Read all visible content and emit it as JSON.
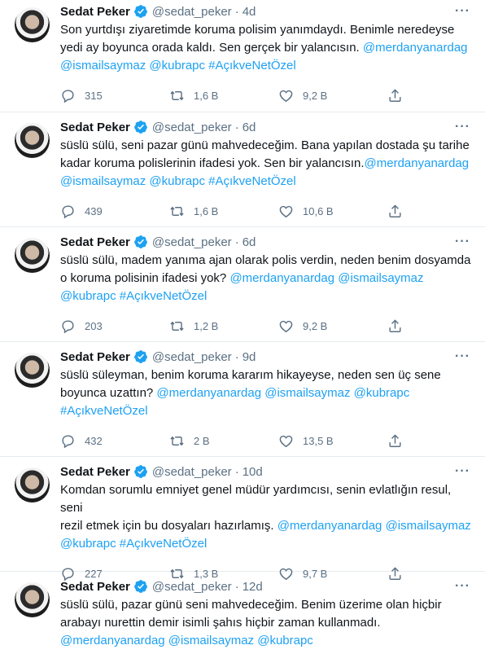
{
  "tweets": [
    {
      "name": "Sedat Peker",
      "handle": "@sedat_peker",
      "time": "4d",
      "text": "Son yurtdışı ziyaretimde koruma polisim yanımdaydı. Benimle neredeyse\nyedi ay boyunca orada kaldı. Sen gerçek bir yalancısın. ",
      "links": "@merdanyanardag\n@ismailsaymaz @kubrapc #AçıkveNetÖzel",
      "replies": "315",
      "retweets": "1,6 B",
      "likes": "9,2 B"
    },
    {
      "name": "Sedat Peker",
      "handle": "@sedat_peker",
      "time": "6d",
      "text": "süslü sülü, seni pazar günü mahvedeceğim. Bana yapılan dostada şu tarihe\nkadar koruma polislerinin ifadesi yok. Sen bir yalancısın.",
      "links": "@merdanyanardag\n@ismailsaymaz @kubrapc #AçıkveNetÖzel",
      "replies": "439",
      "retweets": "1,6 B",
      "likes": "10,6 B"
    },
    {
      "name": "Sedat Peker",
      "handle": "@sedat_peker",
      "time": "6d",
      "text": "süslü sülü, madem yanıma ajan olarak polis verdin, neden benim dosyamda\no koruma polisinin ifadesi yok? ",
      "links": "@merdanyanardag @ismailsaymaz\n@kubrapc #AçıkveNetÖzel",
      "replies": "203",
      "retweets": "1,2 B",
      "likes": "9,2 B"
    },
    {
      "name": "Sedat Peker",
      "handle": "@sedat_peker",
      "time": "9d",
      "text": "süslü süleyman, benim koruma kararım hikayeyse, neden sen üç sene\nboyunca uzattın? ",
      "links": "@merdanyanardag @ismailsaymaz @kubrapc\n#AçıkveNetÖzel",
      "replies": "432",
      "retweets": "2 B",
      "likes": "13,5 B"
    },
    {
      "name": "Sedat Peker",
      "handle": "@sedat_peker",
      "time": "10d",
      "text": "Komdan sorumlu emniyet genel müdür yardımcısı, senin evlatlığın resul, seni\nrezil etmek için bu dosyaları hazırlamış. ",
      "links": "@merdanyanardag @ismailsaymaz\n@kubrapc #AçıkveNetÖzel",
      "replies": "227",
      "retweets": "1,3 B",
      "likes": "9,7 B"
    },
    {
      "name": "Sedat Peker",
      "handle": "@sedat_peker",
      "time": "12d",
      "text": "süslü sülü, pazar günü seni mahvedeceğim. Benim üzerime olan hiçbir\narabayı nurettin demir isimli şahıs hiçbir zaman kullanmadı.\n",
      "links": "@merdanyanardag @ismailsaymaz @kubrapc",
      "replies": "",
      "retweets": "",
      "likes": ""
    }
  ],
  "dot": "·",
  "more_glyph": "···"
}
